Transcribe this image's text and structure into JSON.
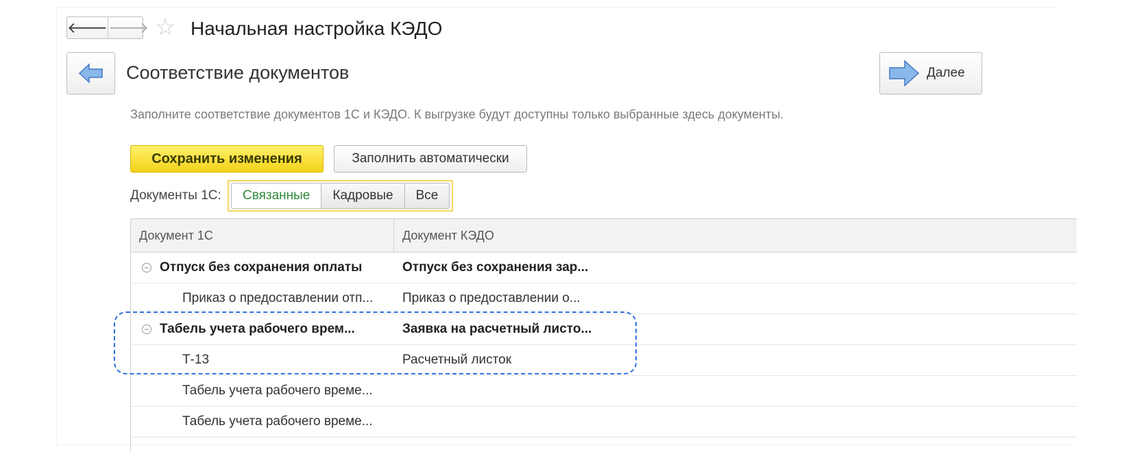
{
  "window": {
    "title": "Начальная настройка КЭДО"
  },
  "nav": {
    "back_glyph": "🡐",
    "forward_glyph": "🡒",
    "favorite_icon": "star-icon"
  },
  "step": {
    "title": "Соответствие документов",
    "next_label": "Далее"
  },
  "hint": "Заполните соответствие документов 1С и КЭДО. К выгрузке будут доступны только выбранные здесь документы.",
  "toolbar": {
    "save_label": "Сохранить изменения",
    "auto_fill_label": "Заполнить автоматически"
  },
  "filter": {
    "label": "Документы 1С:",
    "options": [
      "Связанные",
      "Кадровые",
      "Все"
    ],
    "selected": "Связанные"
  },
  "table": {
    "columns": [
      "Документ 1С",
      "Документ КЭДО"
    ],
    "rows": [
      {
        "type": "group",
        "doc1c": "Отпуск без сохранения оплаты",
        "kedo": "Отпуск без сохранения зар..."
      },
      {
        "type": "child",
        "doc1c": "Приказ о предоставлении отп...",
        "kedo": "Приказ о предоставлении о..."
      },
      {
        "type": "group",
        "doc1c": "Табель учета рабочего врем...",
        "kedo": "Заявка на расчетный листо..."
      },
      {
        "type": "child",
        "doc1c": "Т-13",
        "kedo": "Расчетный листок"
      },
      {
        "type": "child",
        "doc1c": "Табель учета рабочего време...",
        "kedo": ""
      },
      {
        "type": "child",
        "doc1c": "Табель учета рабочего време...",
        "kedo": ""
      }
    ]
  },
  "colors": {
    "accent_save": "#f3d21a",
    "selected_filter_text": "#2f8a3b",
    "highlight_border": "#2d6fe0",
    "arrow_fill": "#8bb8ea"
  }
}
